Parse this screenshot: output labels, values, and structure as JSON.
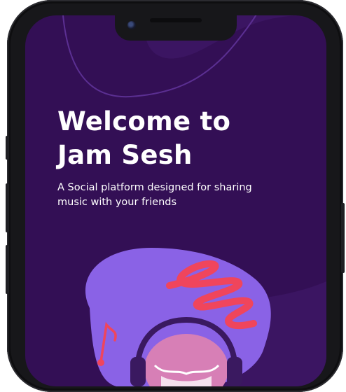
{
  "welcome": {
    "title_line1": "Welcome to",
    "title_line2": "Jam Sesh",
    "subtitle": "A Social platform designed for sharing music with your friends"
  },
  "colors": {
    "screen_background": "#330f55",
    "wave_background": "#3b1562",
    "blob": "#8a62e6",
    "squiggle": "#f0455c",
    "music_note": "#f0455c",
    "face": "#d77fb6",
    "headphones": "#3a1960",
    "phone_frame": "#17171a"
  },
  "icons": [
    "music-note-icon",
    "squiggle-decoration",
    "listener-with-headphones-illustration"
  ]
}
